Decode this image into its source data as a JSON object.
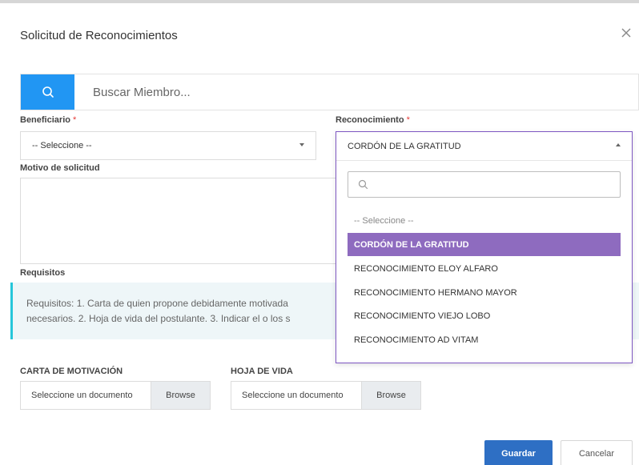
{
  "modal": {
    "title": "Solicitud de Reconocimientos"
  },
  "search": {
    "placeholder": "Buscar Miembro..."
  },
  "form": {
    "beneficiario_label": "Beneficiario",
    "beneficiario_value": "-- Seleccione --",
    "reconocimiento_label": "Reconocimiento",
    "reconocimiento_value": "CORDÓN DE LA GRATITUD",
    "required_mark": "*",
    "motivo_label": "Motivo de solicitud",
    "requisitos_label": "Requisitos",
    "requisitos_line1": "Requisitos: 1. Carta de quien propone debidamente motivada",
    "requisitos_line2": "necesarios. 2. Hoja de vida del postulante. 3. Indicar el o los s"
  },
  "dropdown": {
    "placeholder_option": "-- Seleccione --",
    "options": [
      "CORDÓN DE LA GRATITUD",
      "RECONOCIMIENTO ELOY ALFARO",
      "RECONOCIMIENTO HERMANO MAYOR",
      "RECONOCIMIENTO VIEJO LOBO",
      "RECONOCIMIENTO AD VITAM"
    ],
    "selected_index": 0
  },
  "uploads": {
    "carta_label": "CARTA DE MOTIVACIÓN",
    "hoja_label": "HOJA DE VIDA",
    "file_placeholder": "Seleccione un documento",
    "browse_label": "Browse"
  },
  "actions": {
    "save_label": "Guardar",
    "cancel_label": "Cancelar"
  },
  "colors": {
    "search_button": "#2196f3",
    "selected_option": "#8e6bbf",
    "dropdown_border": "#7e57c2",
    "info_border": "#26c6da",
    "primary_button": "#2e6fc4"
  },
  "icons": {
    "search": "search-icon",
    "close": "close-icon"
  }
}
